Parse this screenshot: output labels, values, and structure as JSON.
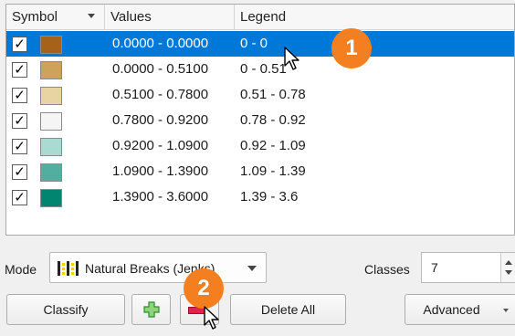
{
  "table": {
    "headers": {
      "symbol": "Symbol",
      "values": "Values",
      "legend": "Legend"
    },
    "rows": [
      {
        "checked": "✓",
        "color": "#a6611a",
        "values": "0.0000 - 0.0000",
        "legend": "0 - 0",
        "selected": true
      },
      {
        "checked": "✓",
        "color": "#cda35c",
        "values": "0.0000 - 0.5100",
        "legend": "0 - 0.51",
        "selected": false
      },
      {
        "checked": "✓",
        "color": "#e7d4a2",
        "values": "0.5100 - 0.7800",
        "legend": "0.51 - 0.78",
        "selected": false
      },
      {
        "checked": "✓",
        "color": "#f5f5f5",
        "values": "0.7800 - 0.9200",
        "legend": "0.78 - 0.92",
        "selected": false
      },
      {
        "checked": "✓",
        "color": "#a9dbd3",
        "values": "0.9200 - 1.0900",
        "legend": "0.92 - 1.09",
        "selected": false
      },
      {
        "checked": "✓",
        "color": "#52ae9f",
        "values": "1.0900 - 1.3900",
        "legend": "1.09 - 1.39",
        "selected": false
      },
      {
        "checked": "✓",
        "color": "#018571",
        "values": "1.3900 - 3.6000",
        "legend": "1.39 - 3.6",
        "selected": false
      }
    ]
  },
  "mode": {
    "label": "Mode",
    "value": "Natural Breaks (Jenks)",
    "icon": "natural-breaks-icon"
  },
  "classes": {
    "label": "Classes",
    "value": "7"
  },
  "buttons": {
    "classify": "Classify",
    "delete_all": "Delete All",
    "advanced": "Advanced"
  },
  "annotations": {
    "badge1": "1",
    "badge2": "2",
    "badge_color": "#f47f20"
  },
  "colors": {
    "selection": "#0078d7"
  }
}
